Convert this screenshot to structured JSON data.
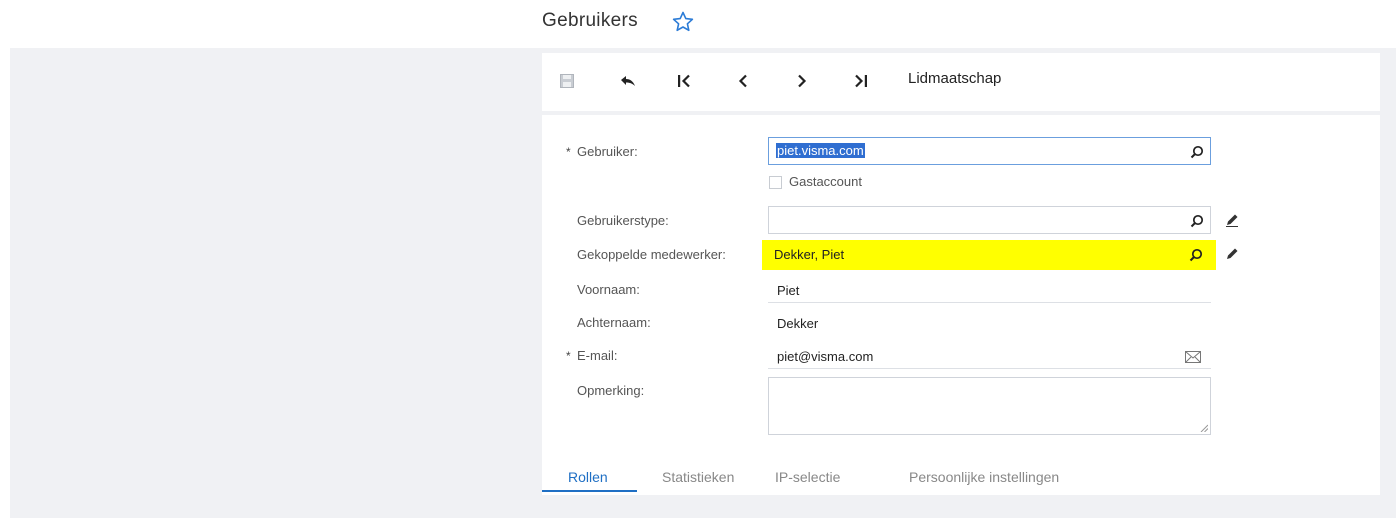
{
  "page": {
    "title": "Gebruikers"
  },
  "toolbar": {
    "membership_label": "Lidmaatschap"
  },
  "form": {
    "user": {
      "label": "Gebruiker:",
      "required_mark": "*",
      "value": "piet.visma.com"
    },
    "guest_account": {
      "label": "Gastaccount",
      "checked": false
    },
    "user_type": {
      "label": "Gebruikerstype:",
      "value": ""
    },
    "linked_employee": {
      "label": "Gekoppelde medewerker:",
      "value": "Dekker, Piet",
      "highlight": "#ffff00"
    },
    "first_name": {
      "label": "Voornaam:",
      "value": "Piet"
    },
    "last_name": {
      "label": "Achternaam:",
      "value": "Dekker"
    },
    "email": {
      "label": "E-mail:",
      "required_mark": "*",
      "value": "piet@visma.com"
    },
    "remark": {
      "label": "Opmerking:",
      "value": ""
    }
  },
  "tabs": [
    {
      "label": "Rollen",
      "active": true
    },
    {
      "label": "Statistieken",
      "active": false
    },
    {
      "label": "IP-selectie",
      "active": false
    },
    {
      "label": "Persoonlijke instellingen",
      "active": false
    }
  ],
  "colors": {
    "accent": "#1f6fc4",
    "selection": "#2f6ed1",
    "highlight": "#ffff00",
    "panel_bg": "#f0f1f4"
  },
  "icons": [
    "star-icon",
    "save-icon",
    "undo-icon",
    "first-icon",
    "previous-icon",
    "next-icon",
    "last-icon",
    "search-icon",
    "pencil-icon",
    "mail-icon"
  ]
}
